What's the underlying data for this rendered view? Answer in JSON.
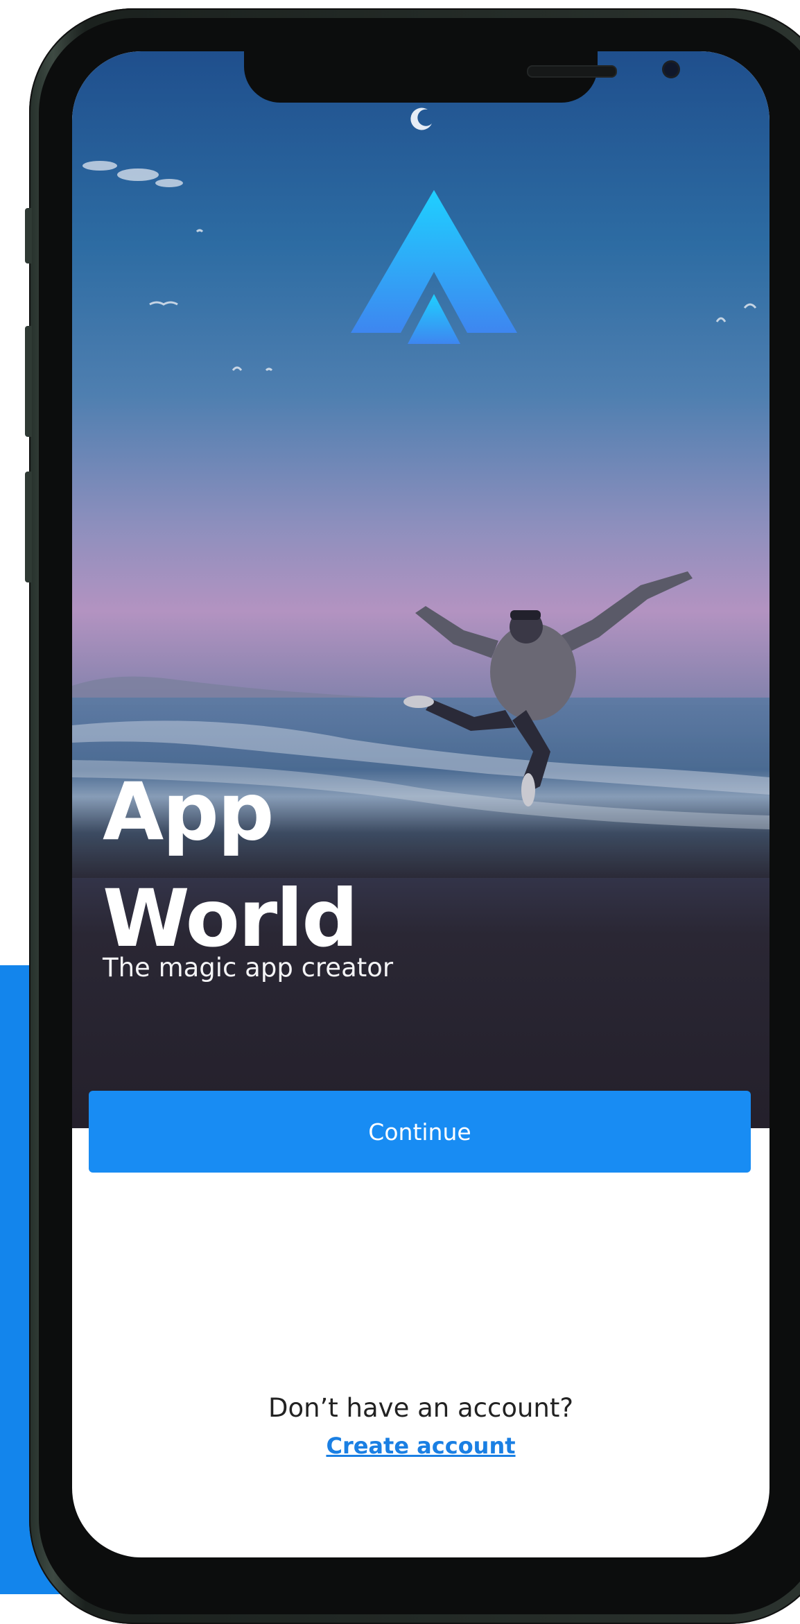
{
  "app": {
    "title_line1": "App",
    "title_line2": "World",
    "tagline": "The magic app creator"
  },
  "actions": {
    "continue_label": "Continue",
    "no_account_text": "Don’t have an account?",
    "create_account_label": "Create account"
  },
  "icons": {
    "logo": "triangle-logo-icon",
    "moon": "crescent-moon-icon"
  },
  "colors": {
    "accent": "#188cf3",
    "link": "#1a7fe3",
    "page_blue": "#1385ec",
    "logo_top": "#1fd0ff",
    "logo_bottom": "#3e86f0"
  }
}
